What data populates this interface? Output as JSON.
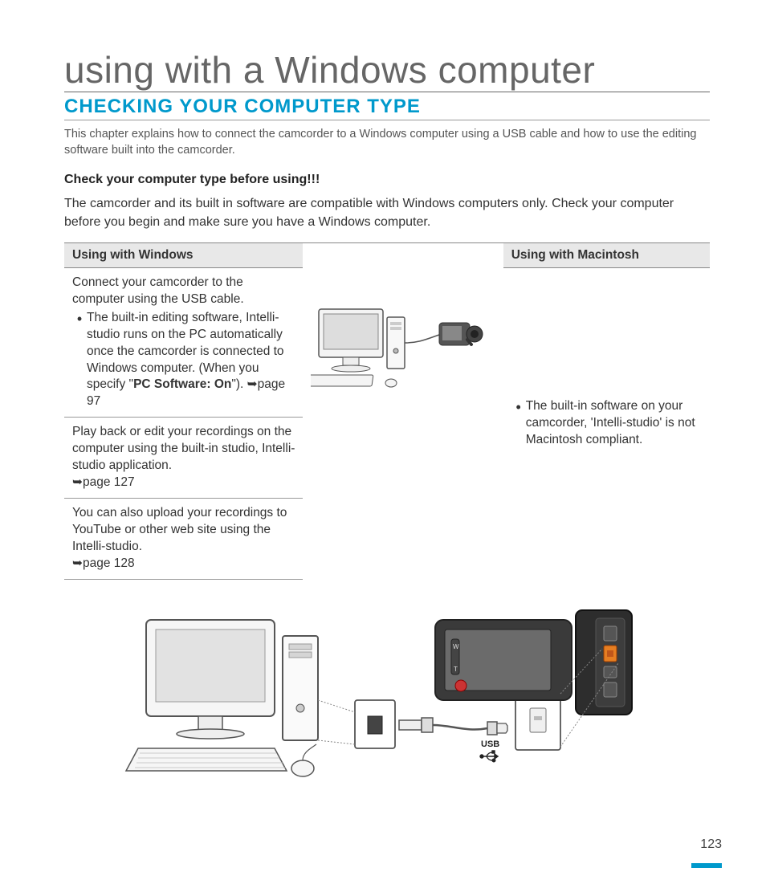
{
  "page_title": "using with a Windows computer",
  "section_title": "CHECKING YOUR COMPUTER TYPE",
  "intro": "This chapter explains how to connect the camcorder to a Windows computer using a USB cable and how to use the editing software built into the camcorder.",
  "check_heading": "Check your computer type before using!!!",
  "check_body": "The camcorder and its built in software are compatible with Windows computers only. Check your computer before you begin and make sure you have a Windows computer.",
  "table": {
    "header_windows": "Using with Windows",
    "header_mac": "Using with Macintosh",
    "win_cell1_lead": "Connect your camcorder to the computer using the USB cable.",
    "win_cell1_bullet_part1": "The built-in editing software, Intelli-studio runs on the PC automatically once the camcorder is connected to Windows computer. (When you specify \"",
    "win_cell1_bullet_bold": "PC Software: On",
    "win_cell1_bullet_part2": "\"). ",
    "win_cell1_ref": "page 97",
    "win_cell2_text": "Play back or edit your recordings on the computer using the built-in studio, Intelli-studio application. ",
    "win_cell2_ref": "page 127",
    "win_cell3_text": "You can also upload your recordings to YouTube or other web site using the Intelli-studio. ",
    "win_cell3_ref": "page 128",
    "mac_bullet": "The built-in software on your camcorder, 'Intelli-studio' is not Macintosh compliant."
  },
  "usb_label": "USB",
  "page_number": "123"
}
